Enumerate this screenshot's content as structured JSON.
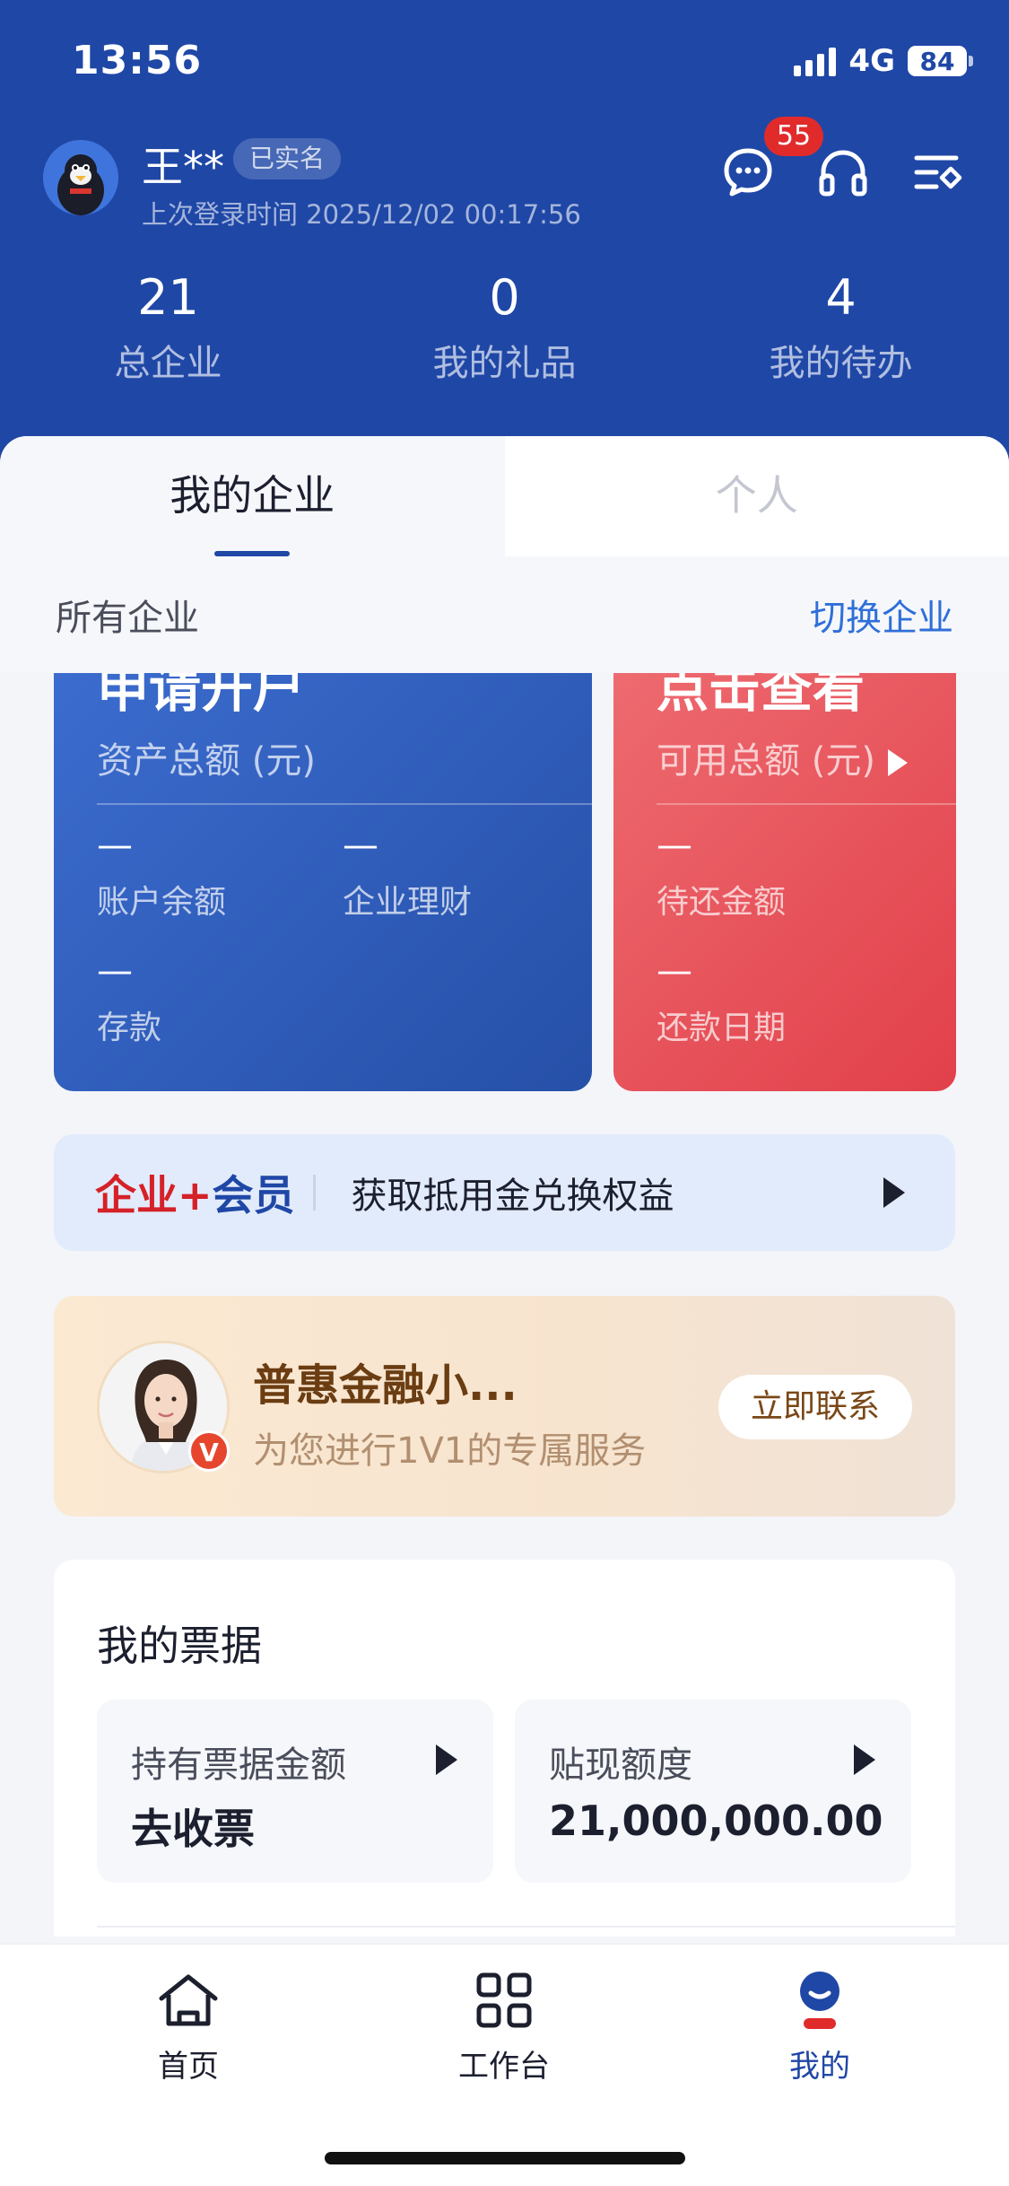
{
  "status_bar": {
    "time": "13:56",
    "network": "4G",
    "battery": "84"
  },
  "user": {
    "name": "王**",
    "verified_label": "已实名",
    "last_login": "上次登录时间 2025/12/02 00:17:56"
  },
  "header_icons": {
    "message_badge": "55",
    "message_icon": "chat-icon",
    "service_icon": "headset-icon",
    "menu_icon": "settings-list-icon"
  },
  "stats": [
    {
      "value": "21",
      "label": "总企业"
    },
    {
      "value": "0",
      "label": "我的礼品"
    },
    {
      "value": "4",
      "label": "我的待办"
    }
  ],
  "tabs": {
    "active": "我的企业",
    "inactive": "个人"
  },
  "filter": {
    "left": "所有企业",
    "right": "切换企业"
  },
  "account_card": {
    "title": "申请开户",
    "subtitle": "资产总额 (元)",
    "items": [
      {
        "value": "—",
        "label": "账户余额"
      },
      {
        "value": "—",
        "label": "企业理财"
      },
      {
        "value": "—",
        "label": "存款"
      }
    ]
  },
  "credit_card": {
    "title": "点击查看",
    "subtitle": "可用总额 (元)",
    "items": [
      {
        "value": "—",
        "label": "待还金额"
      },
      {
        "value": "—",
        "label": "还款日期"
      }
    ]
  },
  "member_banner": {
    "brand_a": "企业+",
    "brand_b": "会员",
    "text": "获取抵用金兑换权益"
  },
  "advisor": {
    "name": "普惠金融小...",
    "desc": "为您进行1V1的专属服务",
    "button": "立即联系",
    "badge": "V"
  },
  "bills": {
    "title": "我的票据",
    "items": [
      {
        "label": "持有票据金额",
        "value": "去收票"
      },
      {
        "label": "贴现额度",
        "value": "21,000,000.00"
      }
    ]
  },
  "nav": [
    {
      "label": "首页",
      "icon": "home-icon"
    },
    {
      "label": "工作台",
      "icon": "grid-icon"
    },
    {
      "label": "我的",
      "icon": "profile-icon"
    }
  ],
  "colors": {
    "primary": "#1f47a6",
    "accent_red": "#e2404a",
    "link": "#2f6fd8"
  }
}
